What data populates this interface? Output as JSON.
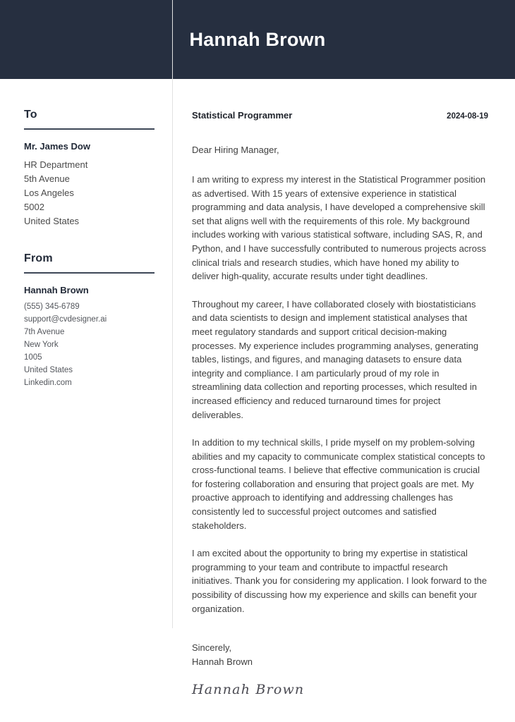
{
  "header": {
    "name": "Hannah Brown"
  },
  "sidebar": {
    "to": {
      "heading": "To",
      "recipient_name": "Mr. James Dow",
      "lines": [
        "HR Department",
        "5th Avenue",
        "Los Angeles",
        "5002",
        "United States"
      ]
    },
    "from": {
      "heading": "From",
      "sender_name": "Hannah Brown",
      "lines": [
        "(555) 345-6789",
        "support@cvdesigner.ai",
        "7th Avenue",
        "New York",
        "1005",
        "United States",
        "Linkedin.com"
      ]
    }
  },
  "letter": {
    "job_title": "Statistical Programmer",
    "date": "2024-08-19",
    "salutation": "Dear Hiring Manager,",
    "paragraphs": [
      "I am writing to express my interest in the Statistical Programmer position as advertised. With 15 years of extensive experience in statistical programming and data analysis, I have developed a comprehensive skill set that aligns well with the requirements of this role. My background includes working with various statistical software, including SAS, R, and Python, and I have successfully contributed to numerous projects across clinical trials and research studies, which have honed my ability to deliver high-quality, accurate results under tight deadlines.",
      "Throughout my career, I have collaborated closely with biostatisticians and data scientists to design and implement statistical analyses that meet regulatory standards and support critical decision-making processes. My experience includes programming analyses, generating tables, listings, and figures, and managing datasets to ensure data integrity and compliance. I am particularly proud of my role in streamlining data collection and reporting processes, which resulted in increased efficiency and reduced turnaround times for project deliverables.",
      "In addition to my technical skills, I pride myself on my problem-solving abilities and my capacity to communicate complex statistical concepts to cross-functional teams. I believe that effective communication is crucial for fostering collaboration and ensuring that project goals are met. My proactive approach to identifying and addressing challenges has consistently led to successful project outcomes and satisfied stakeholders.",
      "I am excited about the opportunity to bring my expertise in statistical programming to your team and contribute to impactful research initiatives. Thank you for considering my application. I look forward to the possibility of discussing how my experience and skills can benefit your organization."
    ],
    "closing_word": "Sincerely,",
    "closing_name": "Hannah Brown",
    "signature": "Hannah Brown"
  },
  "colors": {
    "header_background": "#262f40",
    "section_rule": "#3d4757",
    "divider": "#e2e2e2",
    "body_text": "#3f3f3f"
  }
}
